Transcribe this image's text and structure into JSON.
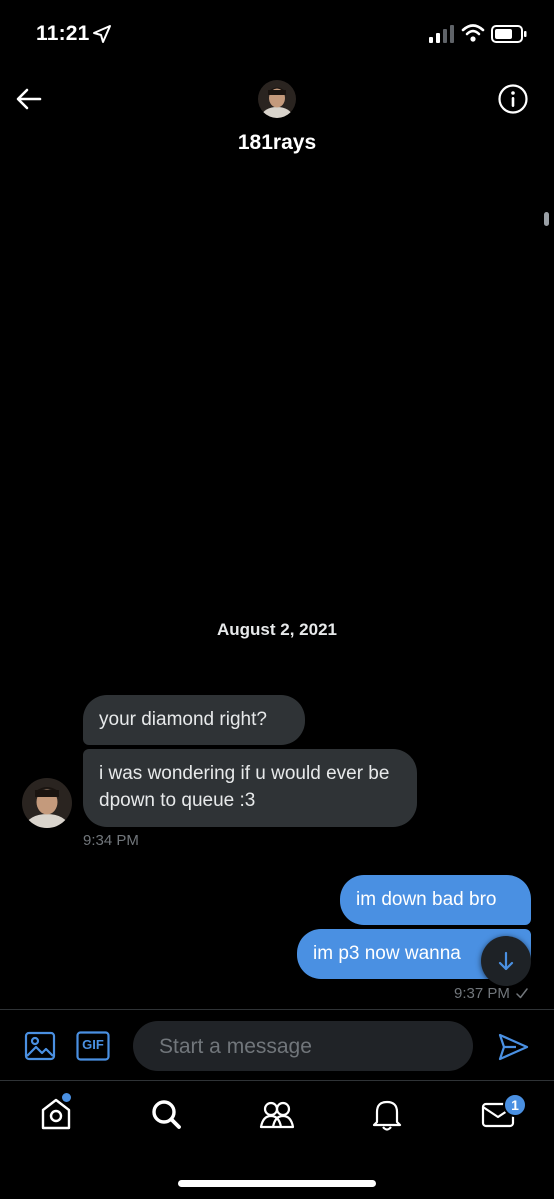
{
  "status_bar": {
    "time": "11:21",
    "icons": [
      "location-arrow-icon",
      "cellular-signal-icon",
      "wifi-icon",
      "battery-icon"
    ]
  },
  "header": {
    "username": "181rays",
    "back_icon": "arrow-left-icon",
    "info_icon": "info-circle-icon"
  },
  "conversation": {
    "date_separator": "August 2, 2021",
    "incoming": {
      "messages": [
        "your diamond right?",
        "i was wondering if u would ever be dpown to queue :3"
      ],
      "time": "9:34 PM"
    },
    "outgoing": {
      "messages": [
        "im down bad bro",
        "im p3 now wanna"
      ],
      "time": "9:37 PM"
    },
    "scroll_down_icon": "arrow-down-icon"
  },
  "composer": {
    "placeholder": "Start a message",
    "media_icon": "image-icon",
    "gif_label": "GIF",
    "send_icon": "send-icon"
  },
  "tab_bar": {
    "items": [
      "home-icon",
      "search-icon",
      "communities-icon",
      "notifications-icon",
      "messages-icon"
    ],
    "messages_badge": "1"
  },
  "colors": {
    "background": "#000000",
    "incoming_bubble": "#2f3336",
    "outgoing_bubble": "#4a90e2",
    "accent": "#4a90e2",
    "muted_text": "#71767b"
  }
}
